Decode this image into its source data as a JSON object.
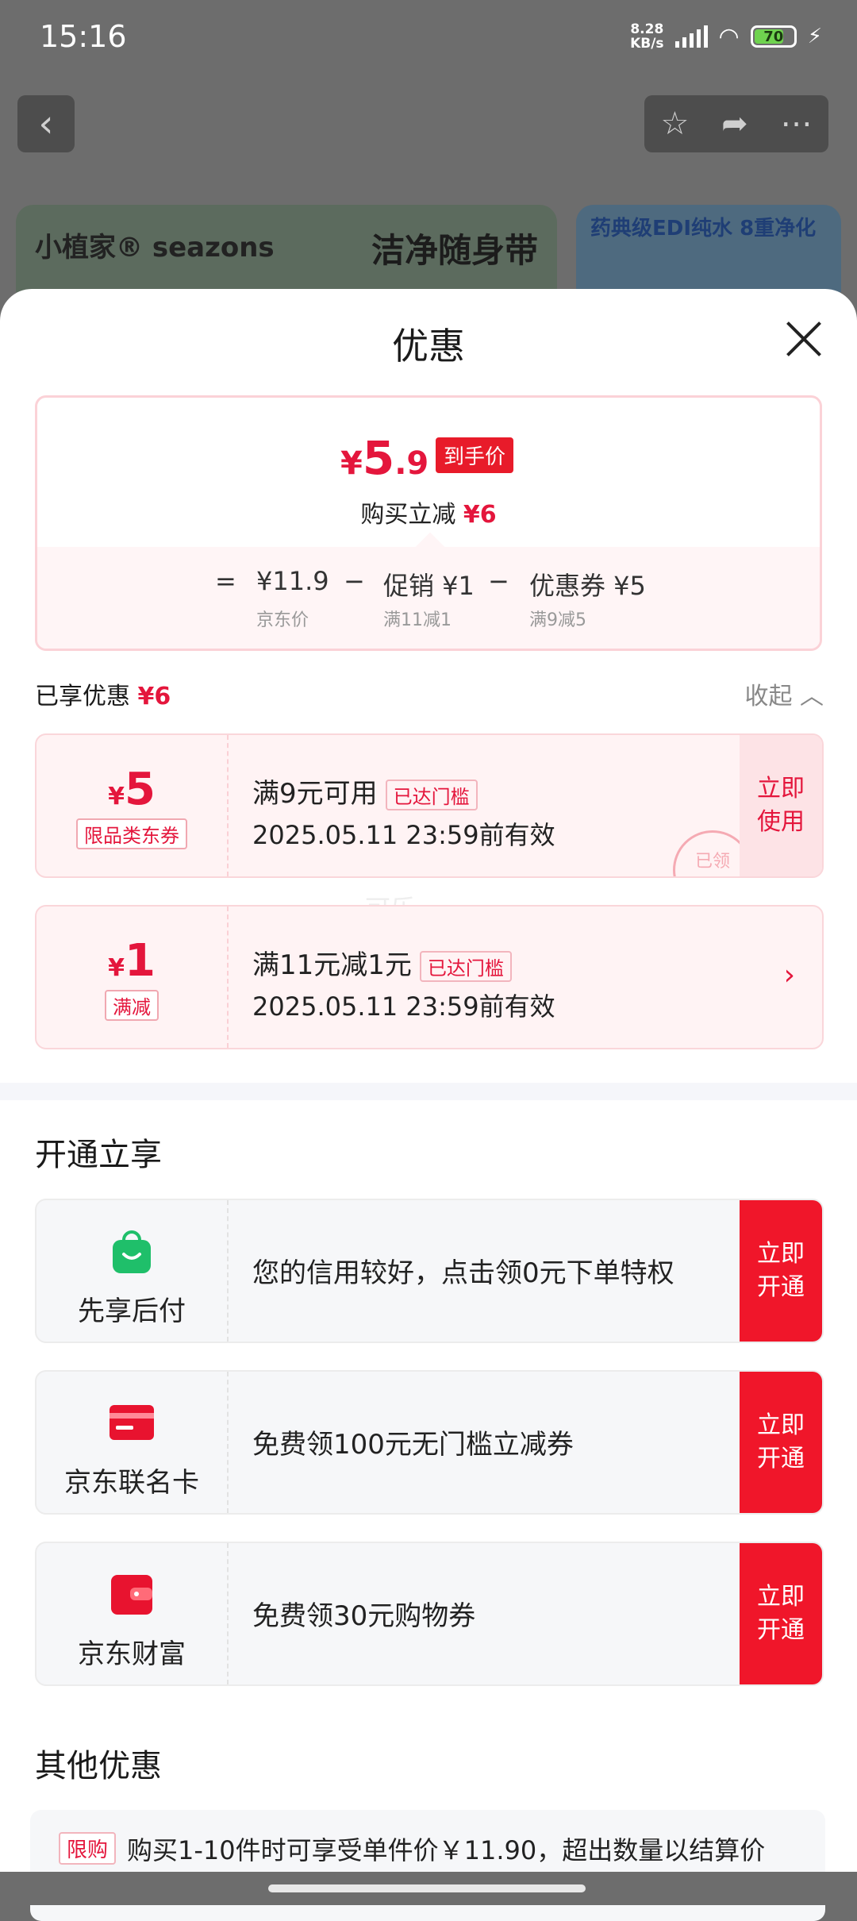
{
  "status": {
    "time": "15:16",
    "speed_top": "8.28",
    "speed_bottom": "KB/s",
    "battery": "70"
  },
  "background": {
    "banner1_brand": "小植家® seazons",
    "banner1_slogan": "洁净随身带",
    "banner2_text": "药典级EDI纯水 8重净化"
  },
  "sheet": {
    "title": "优惠",
    "price": {
      "currency": "¥",
      "integer": "5",
      "decimal": ".9",
      "tag": "到手价",
      "reduce_label": "购买立减",
      "reduce_value": "¥6"
    },
    "calc": [
      {
        "op": "=",
        "value": "¥11.9",
        "sub": "京东价"
      },
      {
        "op": "−",
        "value": "促销 ¥1",
        "sub": "满11减1"
      },
      {
        "op": "−",
        "value": "优惠券 ¥5",
        "sub": "满9减5"
      }
    ],
    "enjoyed_label": "已享优惠",
    "enjoyed_value": "¥6",
    "collapse_label": "收起"
  },
  "coupons": [
    {
      "currency": "¥",
      "amount": "5",
      "type": "限品类东券",
      "title": "满9元可用",
      "threshold": "已达门槛",
      "validity": "2025.05.11 23:59前有效",
      "action": "立即使用",
      "stamp": "已领"
    },
    {
      "currency": "¥",
      "amount": "1",
      "type": "满减",
      "title": "满11元减1元",
      "threshold": "已达门槛",
      "validity": "2025.05.11 23:59前有效",
      "arrow": "›"
    }
  ],
  "watermark": "可乐-",
  "open_section": {
    "title": "开通立享",
    "items": [
      {
        "icon": "bag-icon",
        "name": "先享后付",
        "desc": "您的信用较好，点击领0元下单特权",
        "action": "立即开通",
        "color": "#1fbf6a"
      },
      {
        "icon": "card-icon",
        "name": "京东联名卡",
        "desc": "免费领100元无门槛立减券",
        "action": "立即开通",
        "color": "#e8132f"
      },
      {
        "icon": "wallet-icon",
        "name": "京东财富",
        "desc": "免费领30元购物券",
        "action": "立即开通",
        "color": "#e8132f"
      }
    ]
  },
  "other_section": {
    "title": "其他优惠",
    "tag": "限购",
    "text": "购买1-10件时可享受单件价￥11.90，超出数量以结算价"
  }
}
